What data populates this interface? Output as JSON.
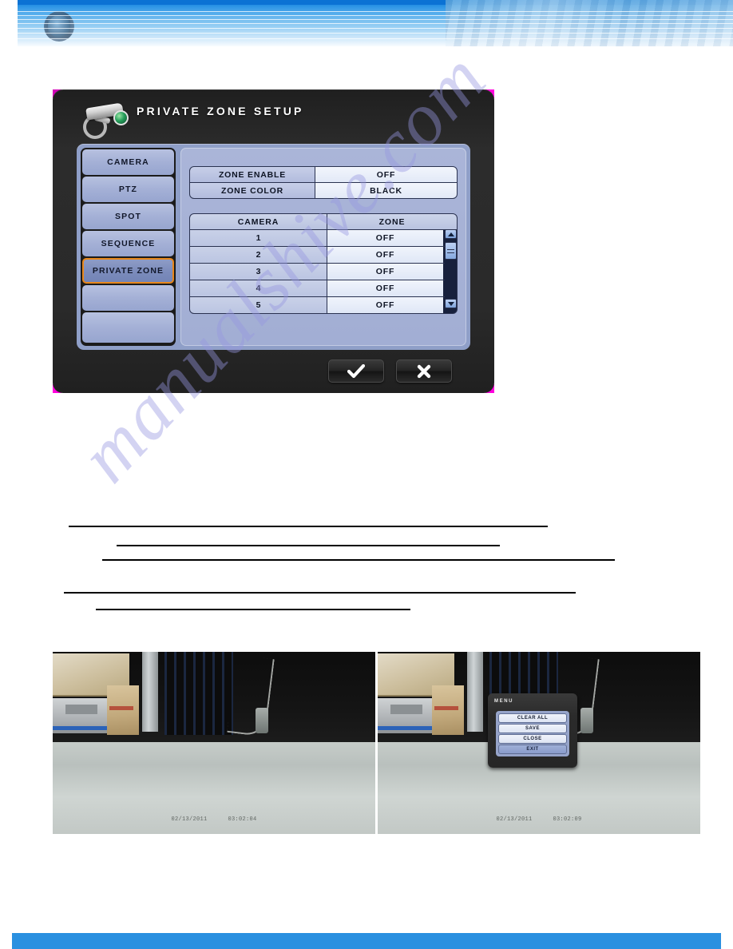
{
  "page": {
    "watermark_text": "manualshive.com"
  },
  "dialog": {
    "title": "PRIVATE ZONE SETUP",
    "icon": "cctv-camera-icon",
    "accent_color": "#e8871a",
    "panel_color": "#a2aed4",
    "menu_items": [
      {
        "label": "CAMERA",
        "selected": false
      },
      {
        "label": "PTZ",
        "selected": false
      },
      {
        "label": "SPOT",
        "selected": false
      },
      {
        "label": "SEQUENCE",
        "selected": false
      },
      {
        "label": "PRIVATE ZONE",
        "selected": true
      },
      {
        "label": "",
        "selected": false
      },
      {
        "label": "",
        "selected": false
      }
    ],
    "options": [
      {
        "label": "ZONE ENABLE",
        "value": "OFF"
      },
      {
        "label": "ZONE COLOR",
        "value": "BLACK"
      }
    ],
    "camera_table": {
      "headers": [
        "CAMERA",
        "ZONE"
      ],
      "rows": [
        {
          "camera": "1",
          "zone": "OFF"
        },
        {
          "camera": "2",
          "zone": "OFF"
        },
        {
          "camera": "3",
          "zone": "OFF"
        },
        {
          "camera": "4",
          "zone": "OFF"
        },
        {
          "camera": "5",
          "zone": "OFF"
        }
      ]
    },
    "scrollbar": {
      "up_icon": "caret-up-icon",
      "down_icon": "caret-down-icon",
      "thumb": "scrollbar-thumb"
    },
    "buttons": [
      {
        "name": "confirm",
        "icon": "checkmark-icon"
      },
      {
        "name": "cancel",
        "icon": "cross-icon"
      }
    ]
  },
  "camera_preview_left": {
    "zone_cell_color": "#e83fa0",
    "osd": {
      "left": "02/13/2011",
      "right": "03:02:04"
    }
  },
  "camera_preview_right": {
    "zone_cell_color": "#e83fa0",
    "osd": {
      "left": "02/13/2011",
      "right": "03:02:09"
    },
    "osd_menu": {
      "title": "MENU",
      "items": [
        {
          "label": "CLEAR ALL",
          "active": false
        },
        {
          "label": "SAVE",
          "active": false
        },
        {
          "label": "CLOSE",
          "active": false
        },
        {
          "label": "EXIT",
          "active": true
        }
      ]
    }
  }
}
